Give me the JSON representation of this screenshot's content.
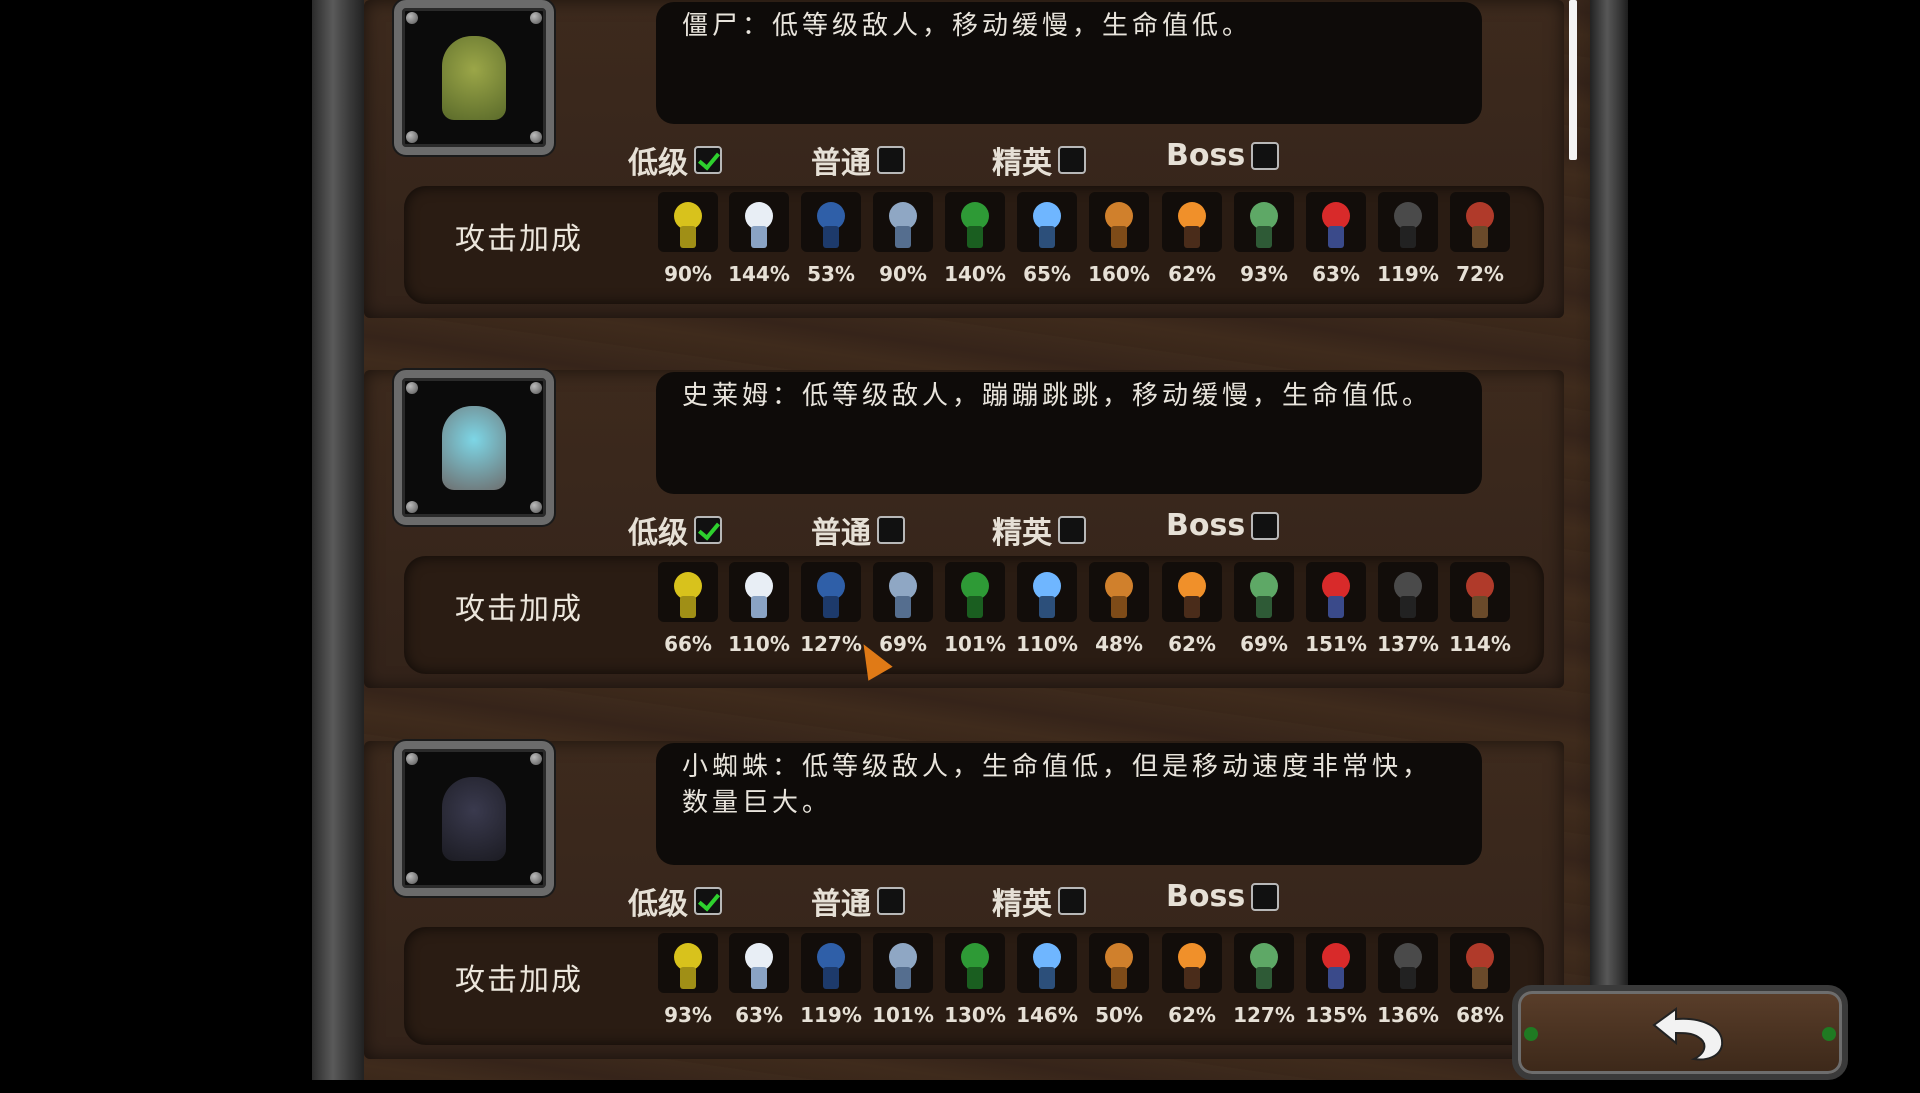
{
  "tier_labels": {
    "low": "低级",
    "normal": "普通",
    "elite": "精英",
    "boss": "Boss"
  },
  "attack_bonus_label": "攻击加成",
  "tower_icons": [
    "yellow-cannon-tower-icon",
    "ice-robot-tower-icon",
    "blue-laser-tower-icon",
    "tesla-cannon-tower-icon",
    "green-gatling-tower-icon",
    "plasma-ufo-tower-icon",
    "orange-rocket-tower-icon",
    "fire-brazier-tower-icon",
    "poison-tower-icon",
    "red-lightning-tower-icon",
    "dark-mortar-tower-icon",
    "red-flag-catapult-tower-icon"
  ],
  "enemies": [
    {
      "name_icon": "zombie-portrait",
      "description": "僵尸：低等级敌人，移动缓慢，生命值低。",
      "tiers": {
        "low": true,
        "normal": false,
        "elite": false,
        "boss": false
      },
      "bonuses": [
        "90%",
        "144%",
        "53%",
        "90%",
        "140%",
        "65%",
        "160%",
        "62%",
        "93%",
        "63%",
        "119%",
        "72%"
      ]
    },
    {
      "name_icon": "slime-portrait",
      "description": "史莱姆：低等级敌人，蹦蹦跳跳，移动缓慢，生命值低。",
      "tiers": {
        "low": true,
        "normal": false,
        "elite": false,
        "boss": false
      },
      "bonuses": [
        "66%",
        "110%",
        "127%",
        "69%",
        "101%",
        "110%",
        "48%",
        "62%",
        "69%",
        "151%",
        "137%",
        "114%"
      ]
    },
    {
      "name_icon": "small-spider-portrait",
      "description": "小蜘蛛：低等级敌人，生命值低，但是移动速度非常快，数量巨大。",
      "tiers": {
        "low": true,
        "normal": false,
        "elite": false,
        "boss": false
      },
      "bonuses": [
        "93%",
        "63%",
        "119%",
        "101%",
        "130%",
        "146%",
        "50%",
        "62%",
        "127%",
        "135%",
        "136%",
        "68%"
      ]
    }
  ],
  "colors": {
    "check": "#2ed12e",
    "wood": "#3d2a1d",
    "text": "#e6e0d6"
  }
}
